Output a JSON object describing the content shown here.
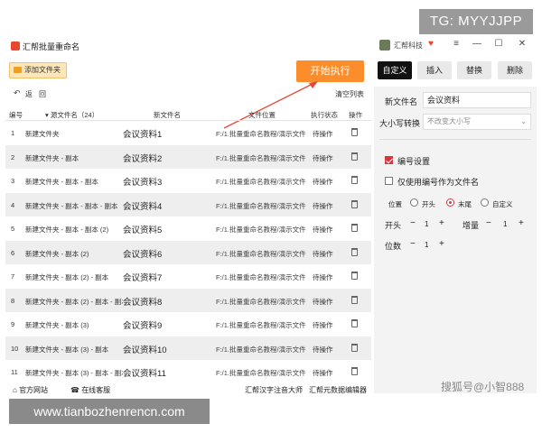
{
  "watermarks": {
    "top": "TG: MYYJJPP",
    "bottom": "www.tianbozhenrencn.com",
    "sohu": "搜狐号@小智888"
  },
  "app": {
    "title": "汇帮批量重命名",
    "user_name": "汇帮科技",
    "window_controls": [
      "≡",
      "—",
      "☐",
      "✕"
    ]
  },
  "toolbar": {
    "add_folder_label": "添加文件夹",
    "start_label": "开始执行"
  },
  "actions": {
    "undo_icon": "↶",
    "undo_label": "返",
    "redo_label": "回",
    "clear_label": "清空列表"
  },
  "table": {
    "headers": {
      "index": "编号",
      "source": "▾ 源文件名（24）",
      "new": "新文件名",
      "path": "文件位置",
      "status": "执行状态",
      "ops": "操作"
    },
    "rows": [
      {
        "index": "1",
        "source": "新建文件夹",
        "new": "会议资料1",
        "path": "F:/1.批量重命名教程/演示文件夹/新",
        "status": "待操作"
      },
      {
        "index": "2",
        "source": "新建文件夹 - 副本",
        "new": "会议资料2",
        "path": "F:/1.批量重命名教程/演示文件夹/新",
        "status": "待操作"
      },
      {
        "index": "3",
        "source": "新建文件夹 - 副本 - 副本",
        "new": "会议资料3",
        "path": "F:/1.批量重命名教程/演示文件夹/新",
        "status": "待操作"
      },
      {
        "index": "4",
        "source": "新建文件夹 - 副本 - 副本 - 副本",
        "new": "会议资料4",
        "path": "F:/1.批量重命名教程/演示文件夹/新",
        "status": "待操作"
      },
      {
        "index": "5",
        "source": "新建文件夹 - 副本 - 副本 (2)",
        "new": "会议资料5",
        "path": "F:/1.批量重命名教程/演示文件夹/新",
        "status": "待操作"
      },
      {
        "index": "6",
        "source": "新建文件夹 - 副本 (2)",
        "new": "会议资料6",
        "path": "F:/1.批量重命名教程/演示文件夹/新",
        "status": "待操作"
      },
      {
        "index": "7",
        "source": "新建文件夹 - 副本 (2) - 副本",
        "new": "会议资料7",
        "path": "F:/1.批量重命名教程/演示文件夹/新",
        "status": "待操作"
      },
      {
        "index": "8",
        "source": "新建文件夹 - 副本 (2) - 副本 - 副本",
        "new": "会议资料8",
        "path": "F:/1.批量重命名教程/演示文件夹/新",
        "status": "待操作"
      },
      {
        "index": "9",
        "source": "新建文件夹 - 副本 (3)",
        "new": "会议资料9",
        "path": "F:/1.批量重命名教程/演示文件夹/新",
        "status": "待操作"
      },
      {
        "index": "10",
        "source": "新建文件夹 - 副本 (3) - 副本",
        "new": "会议资料10",
        "path": "F:/1.批量重命名教程/演示文件夹/新",
        "status": "待操作"
      },
      {
        "index": "11",
        "source": "新建文件夹 - 副本 (3) - 副本 - 副本",
        "new": "会议资料11",
        "path": "F:/1.批量重命名教程/演示文件夹/新",
        "status": "待操作"
      }
    ]
  },
  "footer": {
    "website": "官方网站",
    "service": "在线客服",
    "link1": "汇帮汉字注音大师",
    "link2": "汇帮元数据编辑器"
  },
  "right_panel": {
    "tabs": [
      {
        "label": "自定义",
        "active": true
      },
      {
        "label": "插入",
        "active": false
      },
      {
        "label": "替换",
        "active": false
      },
      {
        "label": "删除",
        "active": false
      }
    ],
    "new_name_label": "新文件名",
    "new_name_value": "会议资料",
    "case_label": "大小写转换",
    "case_value": "不改变大小写",
    "numbering_label": "编号设置",
    "numbering_checked": true,
    "only_number_label": "仅使用编号作为文件名",
    "only_number_checked": false,
    "position_label": "位置",
    "position_options": [
      "开头",
      "末尾",
      "自定义"
    ],
    "position_selected": "末尾",
    "start_label": "开头",
    "start_value": "1",
    "increment_label": "增量",
    "increment_value": "1",
    "digits_label": "位数",
    "digits_value": "1",
    "minus": "−",
    "plus": "+"
  },
  "colors": {
    "accent": "#fb8d2a",
    "active_tab": "#111111",
    "checkbox_red": "#d9363e"
  }
}
